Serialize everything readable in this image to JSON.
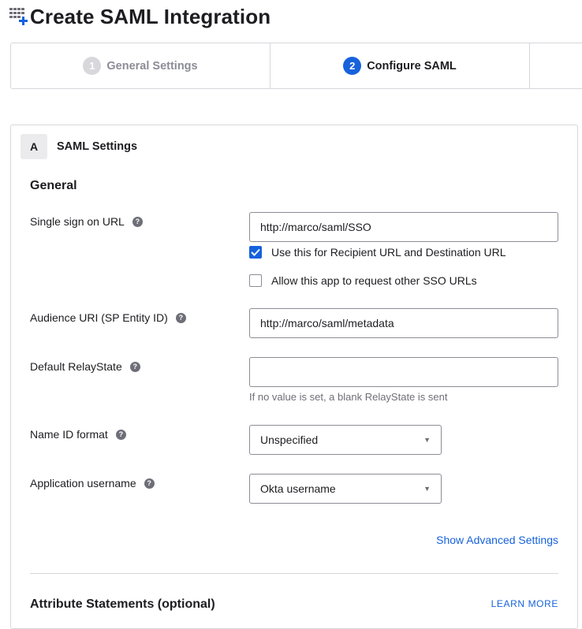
{
  "page": {
    "title": "Create SAML Integration"
  },
  "stepper": {
    "steps": [
      {
        "number": "1",
        "label": "General Settings",
        "state": "completed"
      },
      {
        "number": "2",
        "label": "Configure SAML",
        "state": "active"
      }
    ]
  },
  "section": {
    "letter": "A",
    "title": "SAML Settings",
    "general_heading": "General"
  },
  "form": {
    "sso_url": {
      "label": "Single sign on URL",
      "value": "http://marco/saml/SSO",
      "help_icon": "question-circle-icon"
    },
    "recipient_checkbox": {
      "label": "Use this for Recipient URL and Destination URL",
      "checked": true
    },
    "allow_other_sso_checkbox": {
      "label": "Allow this app to request other SSO URLs",
      "checked": false
    },
    "audience_uri": {
      "label": "Audience URI (SP Entity ID)",
      "value": "http://marco/saml/metadata",
      "help_icon": "question-circle-icon"
    },
    "relay_state": {
      "label": "Default RelayState",
      "value": "",
      "hint": "If no value is set, a blank RelayState is sent",
      "help_icon": "question-circle-icon"
    },
    "name_id_format": {
      "label": "Name ID format",
      "selected": "Unspecified",
      "help_icon": "question-circle-icon"
    },
    "app_username": {
      "label": "Application username",
      "selected": "Okta username",
      "help_icon": "question-circle-icon"
    },
    "advanced_link": "Show Advanced Settings"
  },
  "attributes": {
    "title": "Attribute Statements (optional)",
    "learn_more": "LEARN MORE"
  },
  "colors": {
    "accent": "#1662dd",
    "border": "#d7d7dc",
    "muted_text": "#6e6e78",
    "section_tab_bg": "#ebebed"
  },
  "icons": {
    "title_icon": "grid-plus-icon",
    "select_caret": "caret-down-icon",
    "checkbox_check": "check-icon"
  }
}
